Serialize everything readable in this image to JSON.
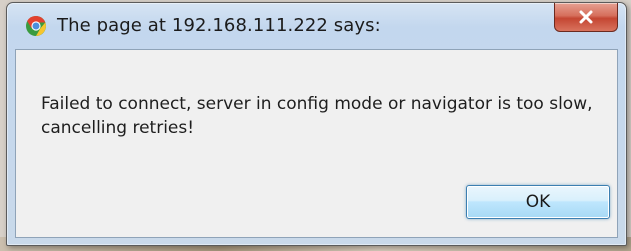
{
  "dialog": {
    "title": "The page at 192.168.111.222 says:",
    "app_icon": "chrome-icon",
    "close_icon": "close-icon",
    "message": "Failed to connect, server in config mode or navigator is too slow, cancelling retries!",
    "ok_label": "OK"
  },
  "colors": {
    "title_bar": "#c9d9ea",
    "close_button": "#c44632",
    "client_background": "#f0f0f0",
    "ok_border": "#3c7fb1"
  }
}
